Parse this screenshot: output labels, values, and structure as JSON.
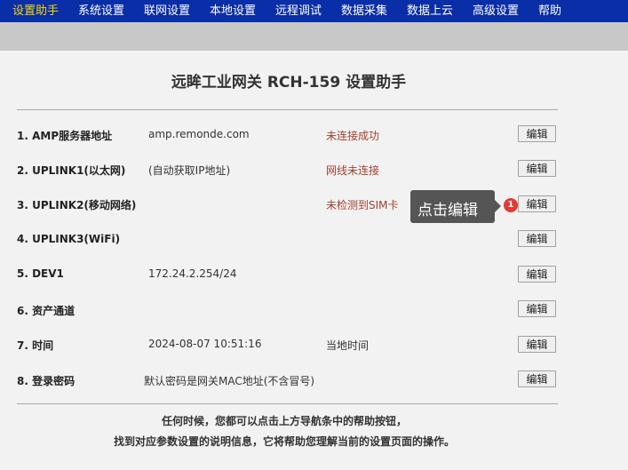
{
  "nav": {
    "items": [
      "设置助手",
      "系统设置",
      "联网设置",
      "本地设置",
      "远程调试",
      "数据采集",
      "数据上云",
      "高级设置",
      "帮助"
    ],
    "active_index": 0
  },
  "page": {
    "title": "远眸工业网关 RCH-159  设置助手"
  },
  "rows": [
    {
      "label": "1. AMP服务器地址",
      "value": "amp.remonde.com",
      "status": "未连接成功"
    },
    {
      "label": "2. UPLINK1(以太网)",
      "value": "(自动获取IP地址)",
      "status": "网线未连接"
    },
    {
      "label": "3. UPLINK2(移动网络)",
      "value": "",
      "status": "未检测到SIM卡"
    },
    {
      "label": "4. UPLINK3(WiFi)",
      "value": "",
      "status": ""
    },
    {
      "label": "5. DEV1",
      "value": "172.24.2.254/24",
      "status": ""
    },
    {
      "label": "6. 资产通道",
      "value": "",
      "status": ""
    },
    {
      "label": "7. 时间",
      "value": "2024-08-07 10:51:16",
      "status": "当地时间"
    },
    {
      "label": "8. 登录密码",
      "value": "默认密码是网关MAC地址(不含冒号)",
      "status": ""
    }
  ],
  "edit_label": "编辑",
  "tooltip": {
    "text": "点击编辑",
    "badge": "1"
  },
  "footer": {
    "line1": "任何时候，您都可以点击上方导航条中的帮助按钮，",
    "line2": "找到对应参数设置的说明信息，它将帮助您理解当前的设置页面的操作。"
  },
  "colors": {
    "nav_bg": "#0a2ea8",
    "nav_active": "#f5d800",
    "status_red": "#a04030",
    "tooltip_bg": "#555555",
    "badge": "#e53935"
  }
}
